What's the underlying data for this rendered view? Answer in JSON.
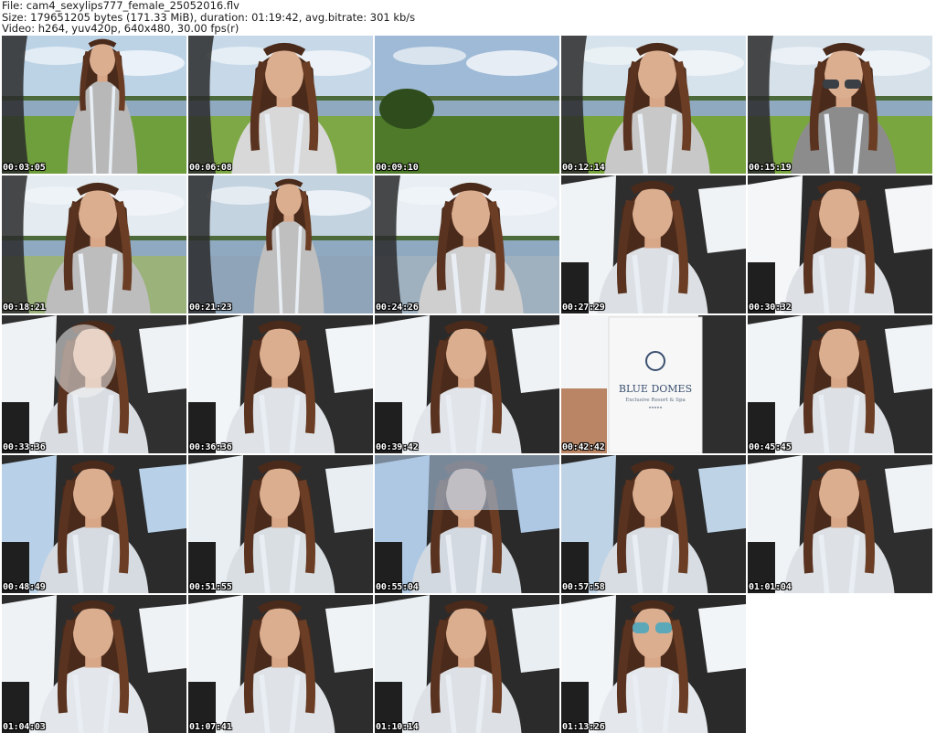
{
  "header": {
    "line1": "File: cam4_sexylips777_female_25052016.flv",
    "line2": "Size: 179651205 bytes (171.33 MiB), duration: 01:19:42, avg.bitrate: 301 kb/s",
    "line3": "Video: h264, yuv420p, 640x480, 30.00 fps(r)"
  },
  "thumbnails": [
    {
      "time": "00:03:05",
      "scene": "outdoor-standing",
      "sky": "#bcd3e6",
      "ground": "#6f9e3c",
      "top": "#b8b8b8"
    },
    {
      "time": "00:06:08",
      "scene": "outdoor-closeup",
      "sky": "#c7d9e8",
      "ground": "#7ea845",
      "top": "#d8d8d8"
    },
    {
      "time": "00:09:10",
      "scene": "sky-landscape",
      "sky": "#9fbad6",
      "ground": "#4e7a2a",
      "top": "#ffffff"
    },
    {
      "time": "00:12:14",
      "scene": "outdoor-bending",
      "sky": "#d7e3ec",
      "ground": "#77a33c",
      "top": "#c8c8c8"
    },
    {
      "time": "00:15:19",
      "scene": "outdoor-sunglasses",
      "sky": "#d6e1ea",
      "ground": "#7aa63f",
      "top": "#8c8c8c"
    },
    {
      "time": "00:18:21",
      "scene": "outdoor-leaning",
      "sky": "#e4ebf1",
      "ground": "#9bb27a",
      "top": "#bdbdbd"
    },
    {
      "time": "00:21:23",
      "scene": "outdoor-standing",
      "sky": "#c4d3e0",
      "ground": "#8fa4b8",
      "top": "#bfbfbf"
    },
    {
      "time": "00:24:26",
      "scene": "outdoor-closeup",
      "sky": "#e8eef3",
      "ground": "#9fb0bf",
      "top": "#cfcfcf"
    },
    {
      "time": "00:27:29",
      "scene": "car-interior",
      "sky": "#f0f3f5",
      "ground": "#2e2e2e",
      "top": "#dcdfe3"
    },
    {
      "time": "00:30:32",
      "scene": "car-interior",
      "sky": "#f4f6f8",
      "ground": "#2b2b2b",
      "top": "#dde1e6"
    },
    {
      "time": "00:33:36",
      "scene": "car-smoke",
      "sky": "#eef2f5",
      "ground": "#303030",
      "top": "#d9dde2"
    },
    {
      "time": "00:36:36",
      "scene": "car-interior",
      "sky": "#f2f5f7",
      "ground": "#2d2d2d",
      "top": "#dfe3e8"
    },
    {
      "time": "00:39:42",
      "scene": "car-interior",
      "sky": "#eef2f5",
      "ground": "#2a2a2a",
      "top": "#e1e5ea"
    },
    {
      "time": "00:42:42",
      "scene": "card",
      "sky": "#f3f4f5",
      "ground": "#3a3a3a",
      "top": "#f7f7f7"
    },
    {
      "time": "00:45:45",
      "scene": "car-interior",
      "sky": "#f1f4f6",
      "ground": "#2c2c2c",
      "top": "#dde1e6"
    },
    {
      "time": "00:48:49",
      "scene": "car-interior",
      "sky": "#b9d1e8",
      "ground": "#2b2b2b",
      "top": "#d6dbe1"
    },
    {
      "time": "00:51:55",
      "scene": "car-interior",
      "sky": "#e9eef2",
      "ground": "#2d2d2d",
      "top": "#d9dee3"
    },
    {
      "time": "00:55:04",
      "scene": "car-sky",
      "sky": "#aec8e4",
      "ground": "#2a2a2a",
      "top": "#d3d9e0"
    },
    {
      "time": "00:57:58",
      "scene": "car-interior",
      "sky": "#bed3e6",
      "ground": "#2b2b2b",
      "top": "#d8dde3"
    },
    {
      "time": "01:01:04",
      "scene": "car-interior",
      "sky": "#f0f3f6",
      "ground": "#2e2e2e",
      "top": "#dde1e6"
    },
    {
      "time": "01:04:03",
      "scene": "car-interior",
      "sky": "#eef2f5",
      "ground": "#2c2c2c",
      "top": "#e3e6ea"
    },
    {
      "time": "01:07:41",
      "scene": "car-interior",
      "sky": "#f0f3f5",
      "ground": "#2d2d2d",
      "top": "#dfe3e7"
    },
    {
      "time": "01:10:14",
      "scene": "car-interior",
      "sky": "#e9eef2",
      "ground": "#2b2b2b",
      "top": "#dde1e6"
    },
    {
      "time": "01:13:26",
      "scene": "car-sunglasses",
      "sky": "#f2f5f7",
      "ground": "#2a2a2a",
      "top": "#e4e8ec"
    }
  ],
  "card": {
    "brand": "BLUE DOMES",
    "tagline": "Exclusive Resort & Spa",
    "stars": "★★★★★"
  }
}
